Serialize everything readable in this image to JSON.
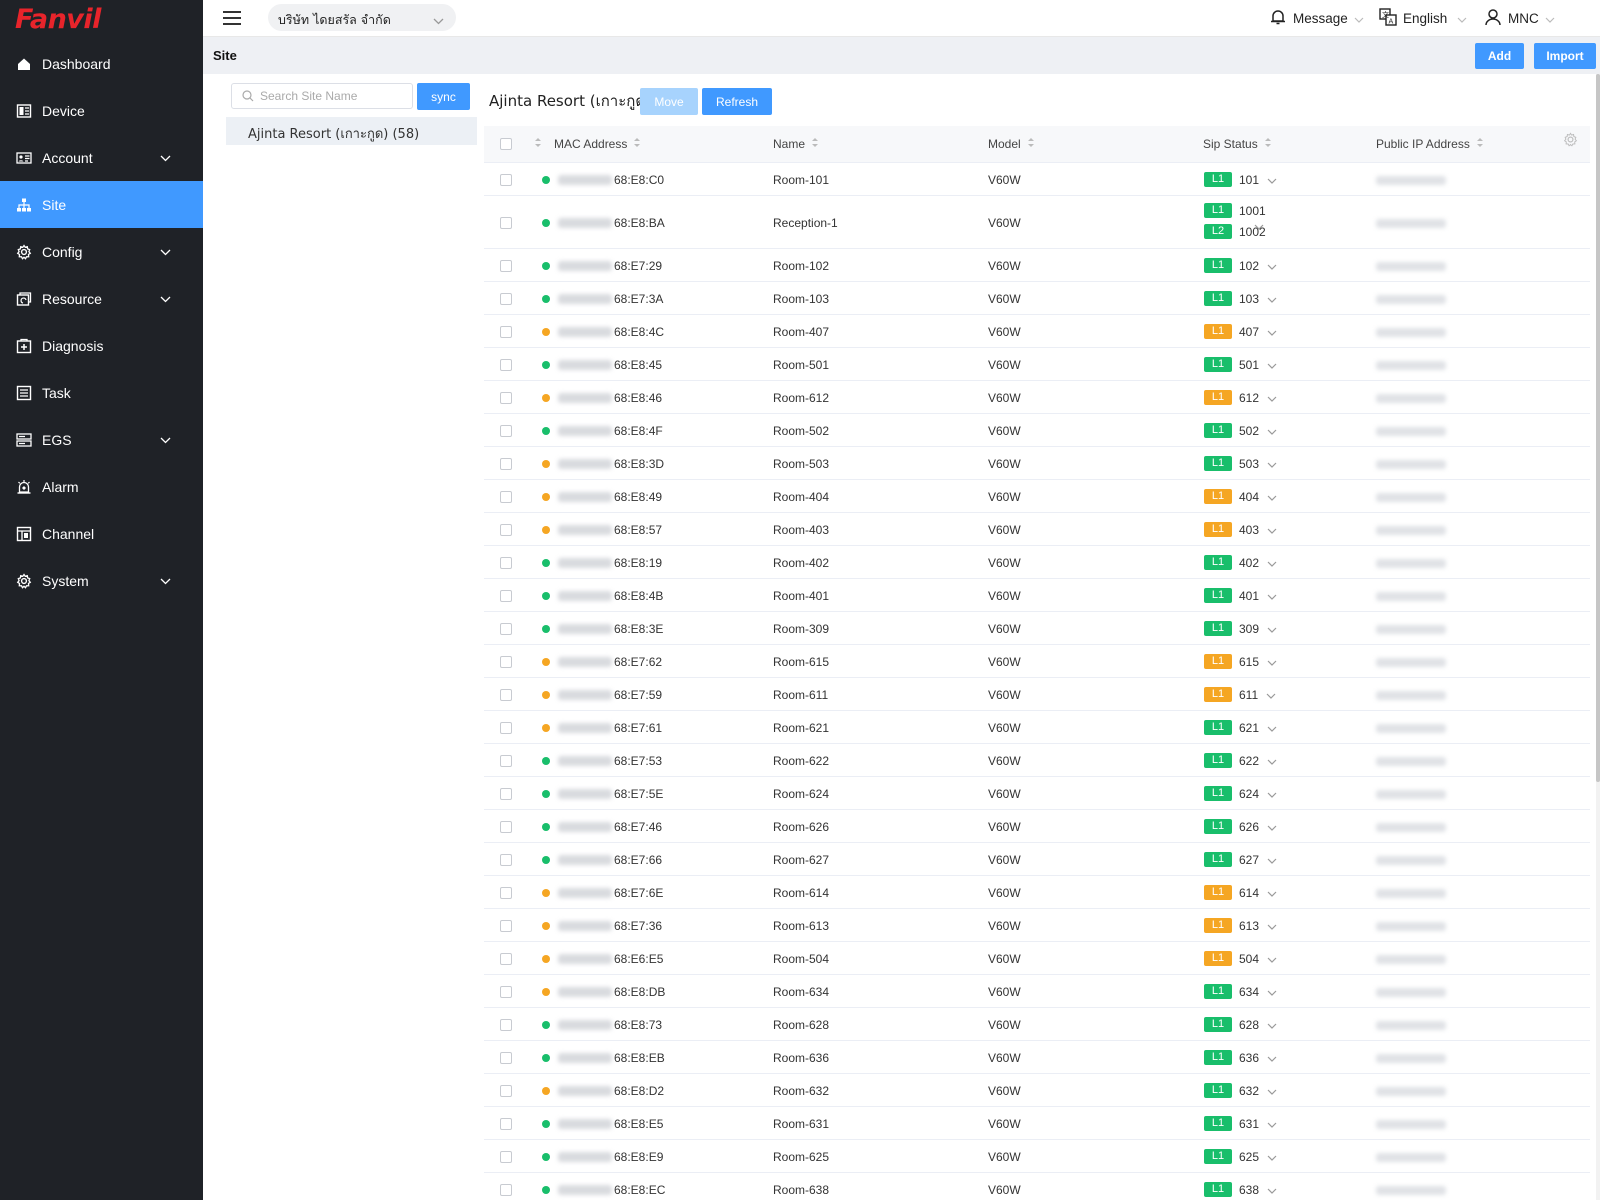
{
  "app": {
    "logo_text": "Fanvil"
  },
  "sidebar": {
    "items": [
      {
        "label": "Dashboard",
        "icon": "home-icon",
        "has_children": false,
        "active": false
      },
      {
        "label": "Device",
        "icon": "device-icon",
        "has_children": false,
        "active": false
      },
      {
        "label": "Account",
        "icon": "account-icon",
        "has_children": true,
        "active": false
      },
      {
        "label": "Site",
        "icon": "site-icon",
        "has_children": false,
        "active": true
      },
      {
        "label": "Config",
        "icon": "config-icon",
        "has_children": true,
        "active": false
      },
      {
        "label": "Resource",
        "icon": "resource-icon",
        "has_children": true,
        "active": false
      },
      {
        "label": "Diagnosis",
        "icon": "diagnosis-icon",
        "has_children": false,
        "active": false
      },
      {
        "label": "Task",
        "icon": "task-icon",
        "has_children": false,
        "active": false
      },
      {
        "label": "EGS",
        "icon": "egs-icon",
        "has_children": true,
        "active": false
      },
      {
        "label": "Alarm",
        "icon": "alarm-icon",
        "has_children": false,
        "active": false
      },
      {
        "label": "Channel",
        "icon": "channel-icon",
        "has_children": false,
        "active": false
      },
      {
        "label": "System",
        "icon": "system-icon",
        "has_children": true,
        "active": false
      }
    ]
  },
  "topbar": {
    "company": "บริษัท ไดยสรัล จำกัด",
    "message_label": "Message",
    "language_label": "English",
    "user_label": "MNC"
  },
  "page": {
    "title": "Site",
    "add_label": "Add",
    "import_label": "Import"
  },
  "site_tree": {
    "search_placeholder": "Search Site Name",
    "sync_label": "sync",
    "node_label": "Ajinta Resort (เกาะกูด) (58)"
  },
  "main": {
    "site_name": "Ajinta Resort (เกาะกูด)",
    "move_label": "Move",
    "refresh_label": "Refresh"
  },
  "colors": {
    "accent": "#4099ff",
    "online": "#19be6b",
    "warning": "#f5a623",
    "sidebar_bg": "#1f2227",
    "brand": "#e8242b"
  },
  "table": {
    "columns": [
      "MAC Address",
      "Name",
      "Model",
      "Sip Status",
      "Public IP Address"
    ],
    "rows": [
      {
        "status": "green",
        "mac": "68:E8:C0",
        "name": "Room-101",
        "model": "V60W",
        "lines": [
          {
            "line": "L1",
            "color": "green",
            "ext": "101"
          }
        ]
      },
      {
        "status": "green",
        "mac": "68:E8:BA",
        "name": "Reception-1",
        "model": "V60W",
        "lines": [
          {
            "line": "L1",
            "color": "green",
            "ext": "1001"
          },
          {
            "line": "L2",
            "color": "green",
            "ext": "1002"
          }
        ]
      },
      {
        "status": "green",
        "mac": "68:E7:29",
        "name": "Room-102",
        "model": "V60W",
        "lines": [
          {
            "line": "L1",
            "color": "green",
            "ext": "102"
          }
        ]
      },
      {
        "status": "green",
        "mac": "68:E7:3A",
        "name": "Room-103",
        "model": "V60W",
        "lines": [
          {
            "line": "L1",
            "color": "green",
            "ext": "103"
          }
        ]
      },
      {
        "status": "orange",
        "mac": "68:E8:4C",
        "name": "Room-407",
        "model": "V60W",
        "lines": [
          {
            "line": "L1",
            "color": "orange",
            "ext": "407"
          }
        ]
      },
      {
        "status": "green",
        "mac": "68:E8:45",
        "name": "Room-501",
        "model": "V60W",
        "lines": [
          {
            "line": "L1",
            "color": "green",
            "ext": "501"
          }
        ]
      },
      {
        "status": "orange",
        "mac": "68:E8:46",
        "name": "Room-612",
        "model": "V60W",
        "lines": [
          {
            "line": "L1",
            "color": "orange",
            "ext": "612"
          }
        ]
      },
      {
        "status": "green",
        "mac": "68:E8:4F",
        "name": "Room-502",
        "model": "V60W",
        "lines": [
          {
            "line": "L1",
            "color": "green",
            "ext": "502"
          }
        ]
      },
      {
        "status": "orange",
        "mac": "68:E8:3D",
        "name": "Room-503",
        "model": "V60W",
        "lines": [
          {
            "line": "L1",
            "color": "green",
            "ext": "503"
          }
        ]
      },
      {
        "status": "orange",
        "mac": "68:E8:49",
        "name": "Room-404",
        "model": "V60W",
        "lines": [
          {
            "line": "L1",
            "color": "orange",
            "ext": "404"
          }
        ]
      },
      {
        "status": "orange",
        "mac": "68:E8:57",
        "name": "Room-403",
        "model": "V60W",
        "lines": [
          {
            "line": "L1",
            "color": "orange",
            "ext": "403"
          }
        ]
      },
      {
        "status": "green",
        "mac": "68:E8:19",
        "name": "Room-402",
        "model": "V60W",
        "lines": [
          {
            "line": "L1",
            "color": "green",
            "ext": "402"
          }
        ]
      },
      {
        "status": "green",
        "mac": "68:E8:4B",
        "name": "Room-401",
        "model": "V60W",
        "lines": [
          {
            "line": "L1",
            "color": "green",
            "ext": "401"
          }
        ]
      },
      {
        "status": "green",
        "mac": "68:E8:3E",
        "name": "Room-309",
        "model": "V60W",
        "lines": [
          {
            "line": "L1",
            "color": "green",
            "ext": "309"
          }
        ]
      },
      {
        "status": "orange",
        "mac": "68:E7:62",
        "name": "Room-615",
        "model": "V60W",
        "lines": [
          {
            "line": "L1",
            "color": "orange",
            "ext": "615"
          }
        ]
      },
      {
        "status": "orange",
        "mac": "68:E7:59",
        "name": "Room-611",
        "model": "V60W",
        "lines": [
          {
            "line": "L1",
            "color": "orange",
            "ext": "611"
          }
        ]
      },
      {
        "status": "orange",
        "mac": "68:E7:61",
        "name": "Room-621",
        "model": "V60W",
        "lines": [
          {
            "line": "L1",
            "color": "green",
            "ext": "621"
          }
        ]
      },
      {
        "status": "green",
        "mac": "68:E7:53",
        "name": "Room-622",
        "model": "V60W",
        "lines": [
          {
            "line": "L1",
            "color": "green",
            "ext": "622"
          }
        ]
      },
      {
        "status": "green",
        "mac": "68:E7:5E",
        "name": "Room-624",
        "model": "V60W",
        "lines": [
          {
            "line": "L1",
            "color": "green",
            "ext": "624"
          }
        ]
      },
      {
        "status": "green",
        "mac": "68:E7:46",
        "name": "Room-626",
        "model": "V60W",
        "lines": [
          {
            "line": "L1",
            "color": "green",
            "ext": "626"
          }
        ]
      },
      {
        "status": "green",
        "mac": "68:E7:66",
        "name": "Room-627",
        "model": "V60W",
        "lines": [
          {
            "line": "L1",
            "color": "green",
            "ext": "627"
          }
        ]
      },
      {
        "status": "orange",
        "mac": "68:E7:6E",
        "name": "Room-614",
        "model": "V60W",
        "lines": [
          {
            "line": "L1",
            "color": "orange",
            "ext": "614"
          }
        ]
      },
      {
        "status": "orange",
        "mac": "68:E7:36",
        "name": "Room-613",
        "model": "V60W",
        "lines": [
          {
            "line": "L1",
            "color": "orange",
            "ext": "613"
          }
        ]
      },
      {
        "status": "orange",
        "mac": "68:E6:E5",
        "name": "Room-504",
        "model": "V60W",
        "lines": [
          {
            "line": "L1",
            "color": "orange",
            "ext": "504"
          }
        ]
      },
      {
        "status": "orange",
        "mac": "68:E8:DB",
        "name": "Room-634",
        "model": "V60W",
        "lines": [
          {
            "line": "L1",
            "color": "green",
            "ext": "634"
          }
        ]
      },
      {
        "status": "green",
        "mac": "68:E8:73",
        "name": "Room-628",
        "model": "V60W",
        "lines": [
          {
            "line": "L1",
            "color": "green",
            "ext": "628"
          }
        ]
      },
      {
        "status": "green",
        "mac": "68:E8:EB",
        "name": "Room-636",
        "model": "V60W",
        "lines": [
          {
            "line": "L1",
            "color": "green",
            "ext": "636"
          }
        ]
      },
      {
        "status": "orange",
        "mac": "68:E8:D2",
        "name": "Room-632",
        "model": "V60W",
        "lines": [
          {
            "line": "L1",
            "color": "green",
            "ext": "632"
          }
        ]
      },
      {
        "status": "green",
        "mac": "68:E8:E5",
        "name": "Room-631",
        "model": "V60W",
        "lines": [
          {
            "line": "L1",
            "color": "green",
            "ext": "631"
          }
        ]
      },
      {
        "status": "green",
        "mac": "68:E8:E9",
        "name": "Room-625",
        "model": "V60W",
        "lines": [
          {
            "line": "L1",
            "color": "green",
            "ext": "625"
          }
        ]
      },
      {
        "status": "green",
        "mac": "68:E8:EC",
        "name": "Room-638",
        "model": "V60W",
        "lines": [
          {
            "line": "L1",
            "color": "green",
            "ext": "638"
          }
        ]
      }
    ]
  }
}
